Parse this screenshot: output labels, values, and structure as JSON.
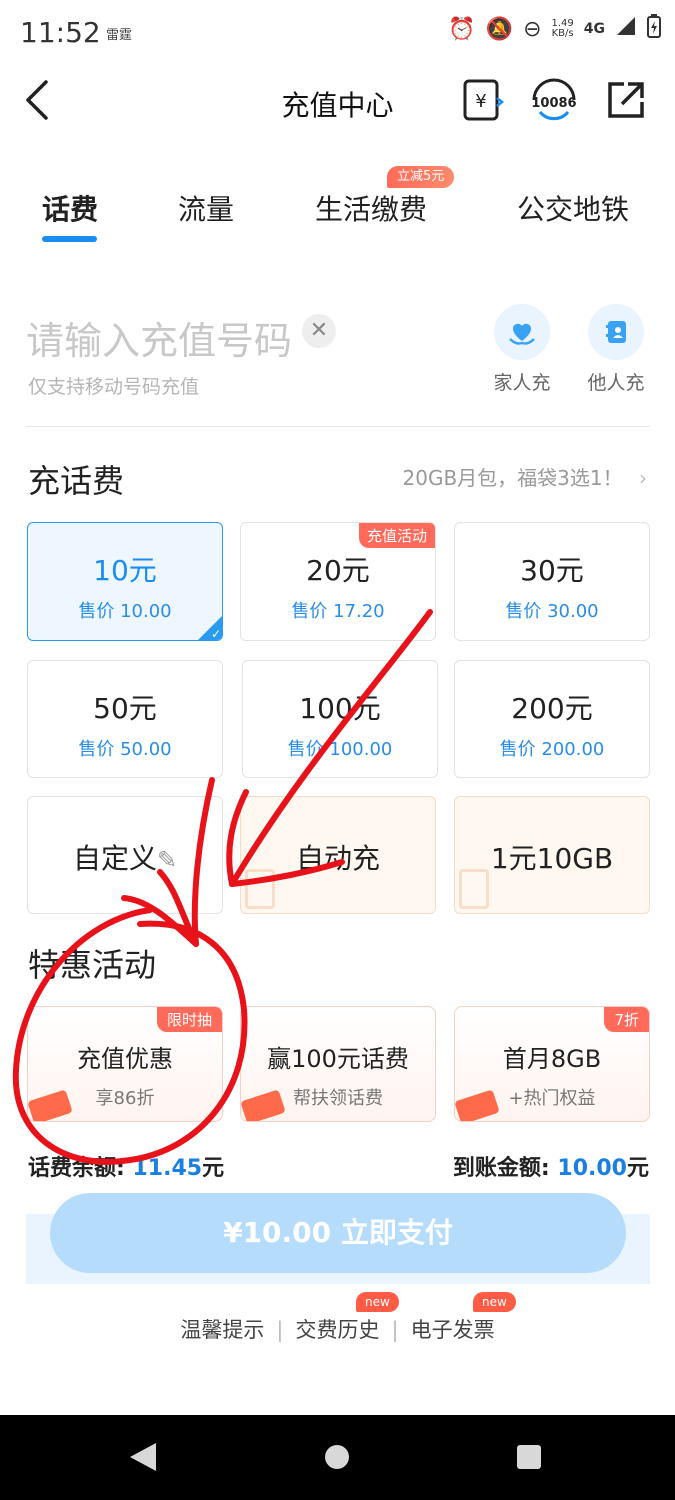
{
  "status_bar": {
    "time": "11:52",
    "carrier": "雷霆",
    "speed": "1.49\nKB/s",
    "network": "4G"
  },
  "header": {
    "title": "充值中心",
    "service_number": "10086"
  },
  "tabs": [
    {
      "label": "话费"
    },
    {
      "label": "流量"
    },
    {
      "label": "生活缴费"
    },
    {
      "label": "公交地铁"
    }
  ],
  "tab_badge": "立减5元",
  "phone": {
    "placeholder": "请输入充值号码",
    "hint": "仅支持移动号码充值"
  },
  "quick_actions": [
    {
      "label": "家人充"
    },
    {
      "label": "他人充"
    }
  ],
  "recharge": {
    "title": "充话费",
    "promo": "20GB月包，福袋3选1！",
    "options": [
      {
        "amount": "10元",
        "price": "售价 10.00"
      },
      {
        "amount": "20元",
        "price": "售价 17.20",
        "tag": "充值活动"
      },
      {
        "amount": "30元",
        "price": "售价 30.00"
      },
      {
        "amount": "50元",
        "price": "售价 50.00"
      },
      {
        "amount": "100元",
        "price": "售价 100.00"
      },
      {
        "amount": "200元",
        "price": "售价 200.00"
      }
    ],
    "extras": [
      {
        "label": "自定义"
      },
      {
        "label": "自动充"
      },
      {
        "label": "1元10GB"
      }
    ]
  },
  "special": {
    "title": "特惠活动",
    "items": [
      {
        "title": "充值优惠",
        "sub": "享86折",
        "tag": "限时抽"
      },
      {
        "title": "赢100元话费",
        "sub": "帮扶领话费"
      },
      {
        "title": "首月8GB",
        "sub": "+热门权益",
        "tag": "7折"
      }
    ]
  },
  "summary": {
    "balance_label": "话费余额: ",
    "balance_value": "11.45",
    "arrive_label": "到账金额: ",
    "arrive_value": "10.00",
    "unit": "元"
  },
  "pay_button": "¥10.00 立即支付",
  "footer_links": [
    {
      "label": "温馨提示"
    },
    {
      "label": "交费历史"
    },
    {
      "label": "电子发票"
    }
  ],
  "new_badge": "new",
  "colors": {
    "accent": "#1a8df0",
    "promo_red": "#ff6a5a",
    "annotation": "#e8121a"
  }
}
